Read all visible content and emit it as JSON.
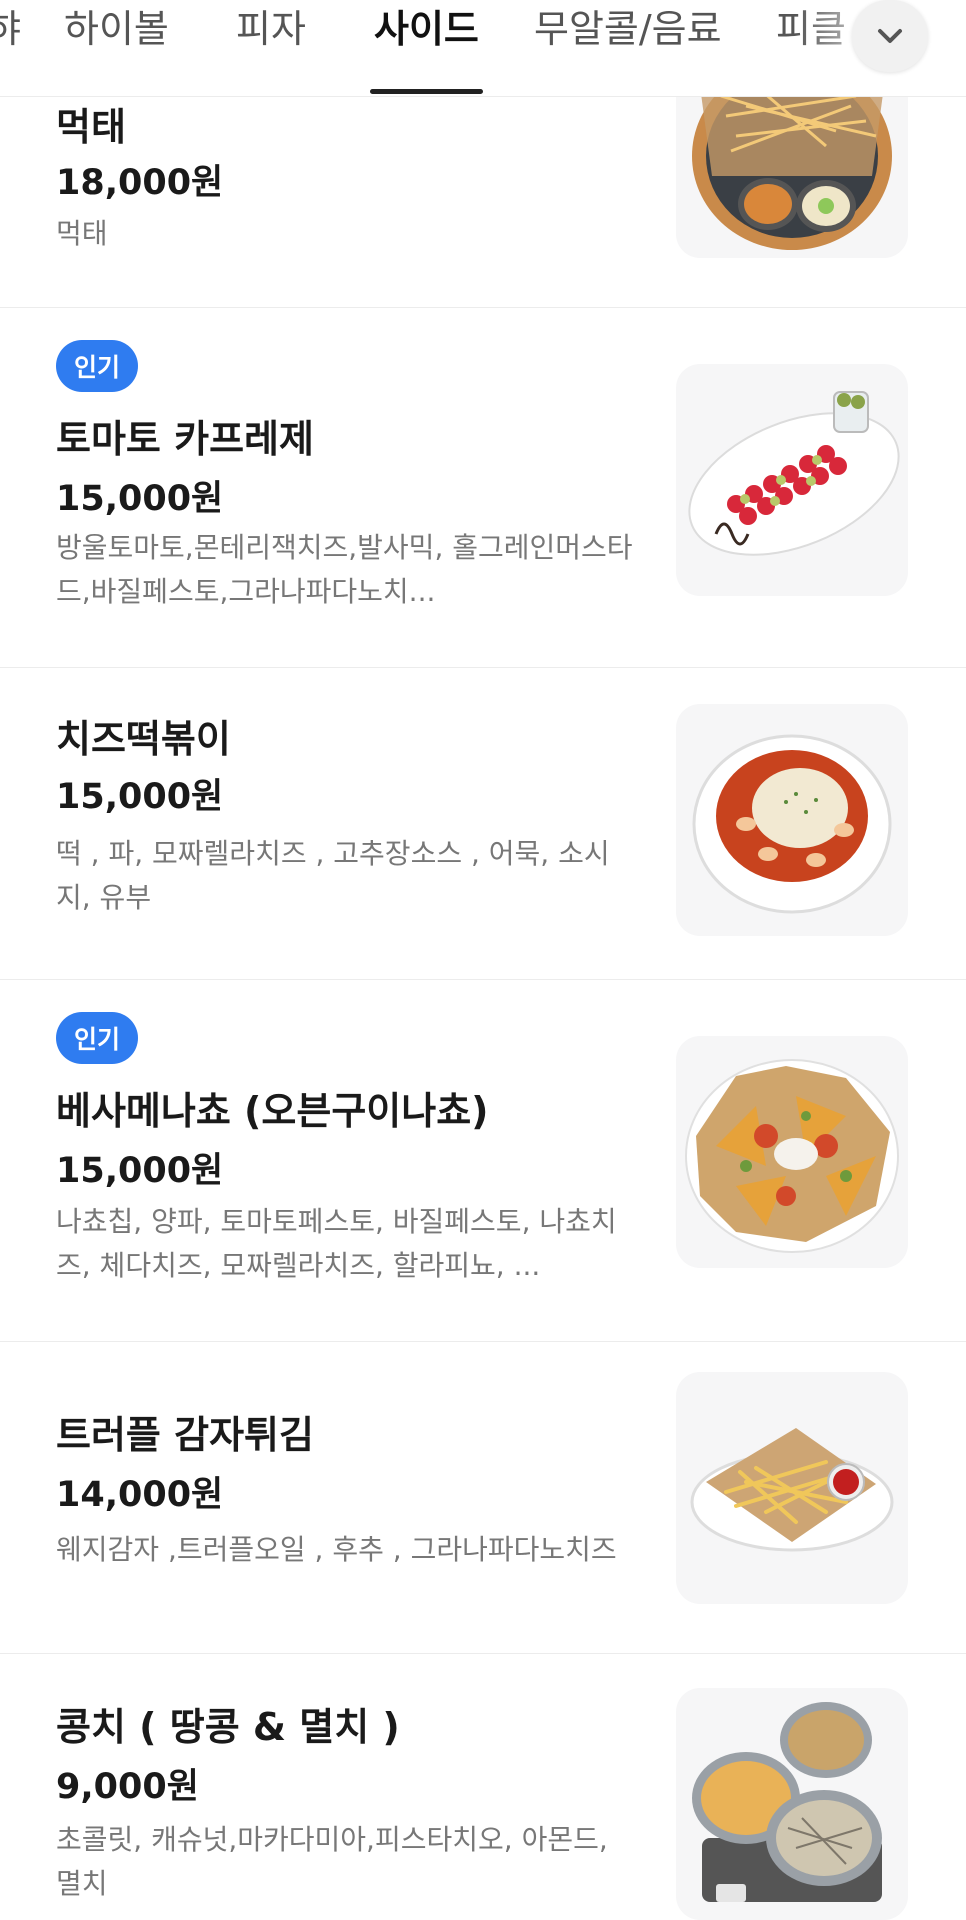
{
  "tabs": [
    {
      "label": "햐"
    },
    {
      "label": "하이볼"
    },
    {
      "label": "피자"
    },
    {
      "label": "사이드"
    },
    {
      "label": "무알콜/음료"
    },
    {
      "label": "피클"
    }
  ],
  "active_tab_index": 3,
  "more_icon": "chevron-down-icon",
  "colors": {
    "badge": "#2f7cf0",
    "tab_active": "#111111"
  },
  "items": [
    {
      "name": "먹태",
      "price": "18,000원",
      "desc": "먹태",
      "badge": ""
    },
    {
      "name": "토마토 카프레제",
      "price": "15,000원",
      "desc": "방울토마토,몬테리잭치즈,발사믹, 홀그레인머스타드,바질페스토,그라나파다노치...",
      "badge": "인기"
    },
    {
      "name": "치즈떡볶이",
      "price": "15,000원",
      "desc": "떡 , 파, 모짜렐라치즈 , 고추장소스 , 어묵, 소시지, 유부",
      "badge": ""
    },
    {
      "name": "베사메나쵸 (오븐구이나쵸)",
      "price": "15,000원",
      "desc": "나쵸칩, 양파, 토마토페스토, 바질페스토, 나쵸치즈, 체다치즈, 모짜렐라치즈, 할라피뇨, ...",
      "badge": "인기"
    },
    {
      "name": "트러플 감자튀김",
      "price": "14,000원",
      "desc": "웨지감자 ,트러플오일 , 후추 , 그라나파다노치즈",
      "badge": ""
    },
    {
      "name": "콩치 ( 땅콩 & 멸치 )",
      "price": "9,000원",
      "desc": "초콜릿, 캐슈넛,마카다미아,피스타치오, 아몬드, 멸치",
      "badge": ""
    }
  ]
}
